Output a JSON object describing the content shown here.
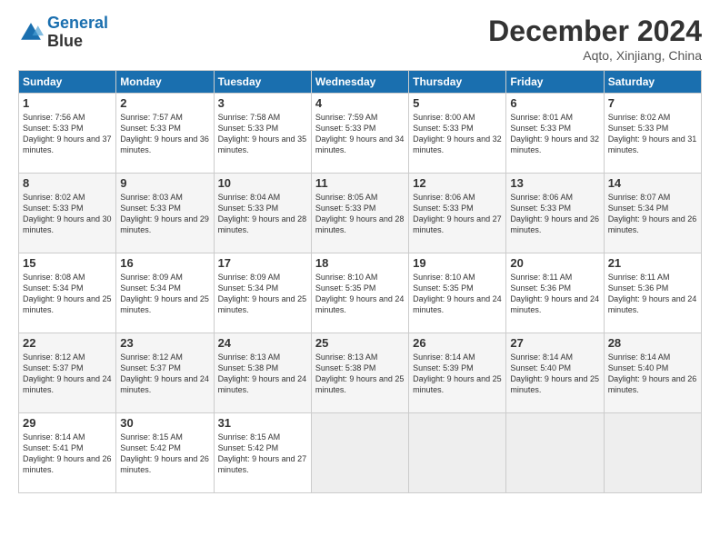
{
  "header": {
    "logo_line1": "General",
    "logo_line2": "Blue",
    "month_title": "December 2024",
    "subtitle": "Aqto, Xinjiang, China"
  },
  "weekdays": [
    "Sunday",
    "Monday",
    "Tuesday",
    "Wednesday",
    "Thursday",
    "Friday",
    "Saturday"
  ],
  "weeks": [
    [
      {
        "day": "1",
        "rise": "7:56 AM",
        "set": "5:33 PM",
        "daylight": "9 hours and 37 minutes."
      },
      {
        "day": "2",
        "rise": "7:57 AM",
        "set": "5:33 PM",
        "daylight": "9 hours and 36 minutes."
      },
      {
        "day": "3",
        "rise": "7:58 AM",
        "set": "5:33 PM",
        "daylight": "9 hours and 35 minutes."
      },
      {
        "day": "4",
        "rise": "7:59 AM",
        "set": "5:33 PM",
        "daylight": "9 hours and 34 minutes."
      },
      {
        "day": "5",
        "rise": "8:00 AM",
        "set": "5:33 PM",
        "daylight": "9 hours and 32 minutes."
      },
      {
        "day": "6",
        "rise": "8:01 AM",
        "set": "5:33 PM",
        "daylight": "9 hours and 32 minutes."
      },
      {
        "day": "7",
        "rise": "8:02 AM",
        "set": "5:33 PM",
        "daylight": "9 hours and 31 minutes."
      }
    ],
    [
      {
        "day": "8",
        "rise": "8:02 AM",
        "set": "5:33 PM",
        "daylight": "9 hours and 30 minutes."
      },
      {
        "day": "9",
        "rise": "8:03 AM",
        "set": "5:33 PM",
        "daylight": "9 hours and 29 minutes."
      },
      {
        "day": "10",
        "rise": "8:04 AM",
        "set": "5:33 PM",
        "daylight": "9 hours and 28 minutes."
      },
      {
        "day": "11",
        "rise": "8:05 AM",
        "set": "5:33 PM",
        "daylight": "9 hours and 28 minutes."
      },
      {
        "day": "12",
        "rise": "8:06 AM",
        "set": "5:33 PM",
        "daylight": "9 hours and 27 minutes."
      },
      {
        "day": "13",
        "rise": "8:06 AM",
        "set": "5:33 PM",
        "daylight": "9 hours and 26 minutes."
      },
      {
        "day": "14",
        "rise": "8:07 AM",
        "set": "5:34 PM",
        "daylight": "9 hours and 26 minutes."
      }
    ],
    [
      {
        "day": "15",
        "rise": "8:08 AM",
        "set": "5:34 PM",
        "daylight": "9 hours and 25 minutes."
      },
      {
        "day": "16",
        "rise": "8:09 AM",
        "set": "5:34 PM",
        "daylight": "9 hours and 25 minutes."
      },
      {
        "day": "17",
        "rise": "8:09 AM",
        "set": "5:34 PM",
        "daylight": "9 hours and 25 minutes."
      },
      {
        "day": "18",
        "rise": "8:10 AM",
        "set": "5:35 PM",
        "daylight": "9 hours and 24 minutes."
      },
      {
        "day": "19",
        "rise": "8:10 AM",
        "set": "5:35 PM",
        "daylight": "9 hours and 24 minutes."
      },
      {
        "day": "20",
        "rise": "8:11 AM",
        "set": "5:36 PM",
        "daylight": "9 hours and 24 minutes."
      },
      {
        "day": "21",
        "rise": "8:11 AM",
        "set": "5:36 PM",
        "daylight": "9 hours and 24 minutes."
      }
    ],
    [
      {
        "day": "22",
        "rise": "8:12 AM",
        "set": "5:37 PM",
        "daylight": "9 hours and 24 minutes."
      },
      {
        "day": "23",
        "rise": "8:12 AM",
        "set": "5:37 PM",
        "daylight": "9 hours and 24 minutes."
      },
      {
        "day": "24",
        "rise": "8:13 AM",
        "set": "5:38 PM",
        "daylight": "9 hours and 24 minutes."
      },
      {
        "day": "25",
        "rise": "8:13 AM",
        "set": "5:38 PM",
        "daylight": "9 hours and 25 minutes."
      },
      {
        "day": "26",
        "rise": "8:14 AM",
        "set": "5:39 PM",
        "daylight": "9 hours and 25 minutes."
      },
      {
        "day": "27",
        "rise": "8:14 AM",
        "set": "5:40 PM",
        "daylight": "9 hours and 25 minutes."
      },
      {
        "day": "28",
        "rise": "8:14 AM",
        "set": "5:40 PM",
        "daylight": "9 hours and 26 minutes."
      }
    ],
    [
      {
        "day": "29",
        "rise": "8:14 AM",
        "set": "5:41 PM",
        "daylight": "9 hours and 26 minutes."
      },
      {
        "day": "30",
        "rise": "8:15 AM",
        "set": "5:42 PM",
        "daylight": "9 hours and 26 minutes."
      },
      {
        "day": "31",
        "rise": "8:15 AM",
        "set": "5:42 PM",
        "daylight": "9 hours and 27 minutes."
      },
      null,
      null,
      null,
      null
    ]
  ]
}
